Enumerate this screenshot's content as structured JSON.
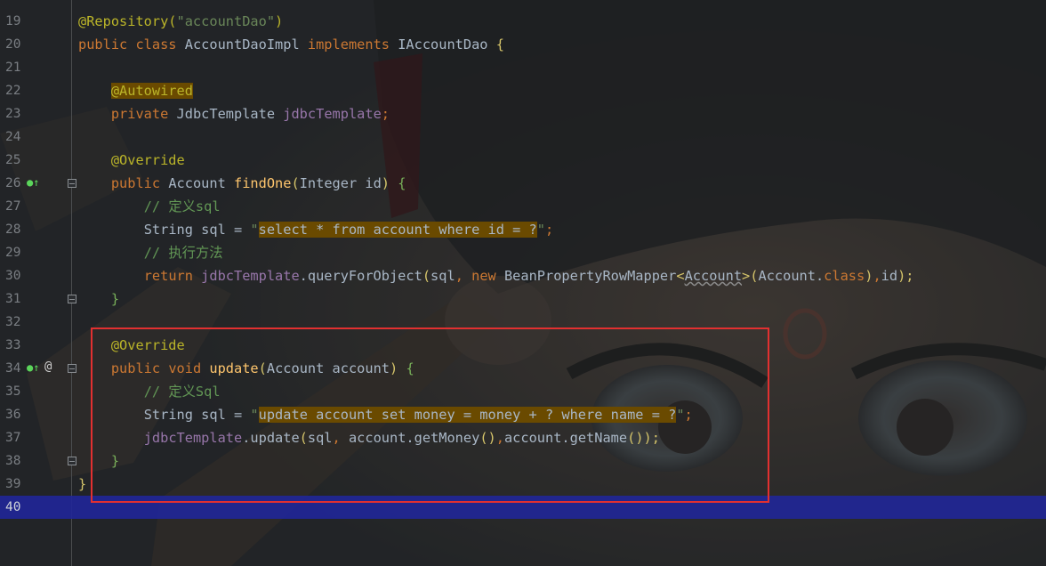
{
  "editor": {
    "lines": [
      {
        "n": "19",
        "segments": [
          {
            "t": "@Repository(",
            "c": "ann"
          },
          {
            "t": "\"accountDao\"",
            "c": "str"
          },
          {
            "t": ")",
            "c": "ann"
          }
        ]
      },
      {
        "n": "20",
        "segments": [
          {
            "t": "public ",
            "c": "kw"
          },
          {
            "t": "class ",
            "c": "kw"
          },
          {
            "t": "AccountDaoImpl ",
            "c": "plain"
          },
          {
            "t": "implements ",
            "c": "kw"
          },
          {
            "t": "IAccountDao ",
            "c": "plain"
          },
          {
            "t": "{",
            "c": "paren"
          }
        ]
      },
      {
        "n": "21",
        "segments": []
      },
      {
        "n": "22",
        "segments": [
          {
            "t": "    ",
            "c": "plain"
          },
          {
            "t": "@Autowired",
            "c": "ann-hl"
          }
        ]
      },
      {
        "n": "23",
        "segments": [
          {
            "t": "    ",
            "c": "plain"
          },
          {
            "t": "private ",
            "c": "kw"
          },
          {
            "t": "JdbcTemplate ",
            "c": "plain"
          },
          {
            "t": "jdbcTemplate",
            "c": "field"
          },
          {
            "t": ";",
            "c": "kw"
          }
        ]
      },
      {
        "n": "24",
        "segments": []
      },
      {
        "n": "25",
        "segments": [
          {
            "t": "    ",
            "c": "plain"
          },
          {
            "t": "@Override",
            "c": "ann"
          }
        ]
      },
      {
        "n": "26",
        "markers": [
          "impl"
        ],
        "fold": true,
        "segments": [
          {
            "t": "    ",
            "c": "plain"
          },
          {
            "t": "public ",
            "c": "kw"
          },
          {
            "t": "Account ",
            "c": "plain"
          },
          {
            "t": "findOne",
            "c": "method"
          },
          {
            "t": "(",
            "c": "paren"
          },
          {
            "t": "Integer id",
            "c": "plain"
          },
          {
            "t": ") ",
            "c": "paren"
          },
          {
            "t": "{",
            "c": "brace"
          }
        ]
      },
      {
        "n": "27",
        "segments": [
          {
            "t": "        ",
            "c": "plain"
          },
          {
            "t": "// 定义sql",
            "c": "comment"
          }
        ]
      },
      {
        "n": "28",
        "segments": [
          {
            "t": "        ",
            "c": "plain"
          },
          {
            "t": "String sql = ",
            "c": "plain"
          },
          {
            "t": "\"",
            "c": "str-q"
          },
          {
            "t": "select * from account where id = ?",
            "c": "str-hl"
          },
          {
            "t": "\"",
            "c": "str-q"
          },
          {
            "t": ";",
            "c": "kw"
          }
        ]
      },
      {
        "n": "29",
        "segments": [
          {
            "t": "        ",
            "c": "plain"
          },
          {
            "t": "// 执行方法",
            "c": "comment"
          }
        ]
      },
      {
        "n": "30",
        "segments": [
          {
            "t": "        ",
            "c": "plain"
          },
          {
            "t": "return ",
            "c": "kw"
          },
          {
            "t": "jdbcTemplate",
            "c": "field"
          },
          {
            "t": ".queryForObject",
            "c": "plain"
          },
          {
            "t": "(",
            "c": "paren"
          },
          {
            "t": "sql",
            "c": "plain"
          },
          {
            "t": ", ",
            "c": "kw"
          },
          {
            "t": "new ",
            "c": "kw"
          },
          {
            "t": "BeanPropertyRowMapper",
            "c": "plain"
          },
          {
            "t": "<",
            "c": "paren"
          },
          {
            "t": "Account",
            "c": "wavy"
          },
          {
            "t": ">",
            "c": "paren"
          },
          {
            "t": "(",
            "c": "paren"
          },
          {
            "t": "Account.",
            "c": "plain"
          },
          {
            "t": "class",
            "c": "kw"
          },
          {
            "t": ")",
            "c": "paren"
          },
          {
            "t": ",",
            "c": "kw"
          },
          {
            "t": "id",
            "c": "plain"
          },
          {
            "t": ");",
            "c": "paren"
          }
        ]
      },
      {
        "n": "31",
        "fold": true,
        "segments": [
          {
            "t": "    ",
            "c": "plain"
          },
          {
            "t": "}",
            "c": "brace"
          }
        ]
      },
      {
        "n": "32",
        "segments": []
      },
      {
        "n": "33",
        "segments": [
          {
            "t": "    ",
            "c": "plain"
          },
          {
            "t": "@Override",
            "c": "ann"
          }
        ]
      },
      {
        "n": "34",
        "markers": [
          "impl",
          "at"
        ],
        "fold": true,
        "segments": [
          {
            "t": "    ",
            "c": "plain"
          },
          {
            "t": "public ",
            "c": "kw"
          },
          {
            "t": "void ",
            "c": "kw"
          },
          {
            "t": "update",
            "c": "method"
          },
          {
            "t": "(",
            "c": "paren"
          },
          {
            "t": "Account account",
            "c": "plain"
          },
          {
            "t": ") ",
            "c": "paren"
          },
          {
            "t": "{",
            "c": "brace"
          }
        ]
      },
      {
        "n": "35",
        "segments": [
          {
            "t": "        ",
            "c": "plain"
          },
          {
            "t": "// 定义Sql",
            "c": "comment"
          }
        ]
      },
      {
        "n": "36",
        "segments": [
          {
            "t": "        ",
            "c": "plain"
          },
          {
            "t": "String sql = ",
            "c": "plain"
          },
          {
            "t": "\"",
            "c": "str-q"
          },
          {
            "t": "update account set money = money + ? where name = ?",
            "c": "str-hl"
          },
          {
            "t": "\"",
            "c": "str-q"
          },
          {
            "t": ";",
            "c": "kw"
          }
        ]
      },
      {
        "n": "37",
        "segments": [
          {
            "t": "        ",
            "c": "plain"
          },
          {
            "t": "jdbcTemplate",
            "c": "field"
          },
          {
            "t": ".update",
            "c": "plain"
          },
          {
            "t": "(",
            "c": "paren"
          },
          {
            "t": "sql",
            "c": "plain"
          },
          {
            "t": ", ",
            "c": "kw"
          },
          {
            "t": "account.getMoney",
            "c": "plain"
          },
          {
            "t": "()",
            "c": "paren"
          },
          {
            "t": ",",
            "c": "kw"
          },
          {
            "t": "account.getName",
            "c": "plain"
          },
          {
            "t": "()",
            "c": "paren"
          },
          {
            "t": ");",
            "c": "paren"
          }
        ]
      },
      {
        "n": "38",
        "fold": true,
        "segments": [
          {
            "t": "    ",
            "c": "plain"
          },
          {
            "t": "}",
            "c": "brace"
          }
        ]
      },
      {
        "n": "39",
        "segments": [
          {
            "t": "}",
            "c": "paren"
          }
        ]
      },
      {
        "n": "40",
        "current": true,
        "segments": []
      }
    ],
    "markers": {
      "impl": "●↑",
      "at": "@"
    }
  },
  "colors": {
    "keyword": "#cc7832",
    "annotation": "#bbb529",
    "string": "#6a8759",
    "field": "#9876aa",
    "method": "#ffc66d",
    "comment": "#629755",
    "plain": "#a9b7c6",
    "current_line": "#21269a",
    "highlight_box": "#e23030"
  }
}
